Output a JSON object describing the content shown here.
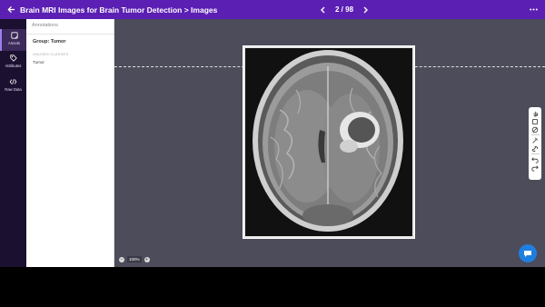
{
  "header": {
    "title": "Brain MRI Images for Brain Tumor Detection > Images",
    "pager_text": "2 / 98"
  },
  "leftnav": {
    "items": [
      {
        "label": "Annots",
        "icon": "annotation-icon"
      },
      {
        "label": "Attributes",
        "icon": "tag-icon"
      },
      {
        "label": "Raw Data",
        "icon": "code-icon"
      }
    ]
  },
  "panel": {
    "header": "Annotations",
    "group_label": "Group: Tumor",
    "unused_label": "UNUSED CLASSES",
    "classes": [
      "Tumor"
    ]
  },
  "zoom": {
    "value": "100%"
  },
  "colors": {
    "topbar": "#5b1fb3",
    "canvas": "#4c4c5a",
    "chat": "#1e7fe0"
  }
}
